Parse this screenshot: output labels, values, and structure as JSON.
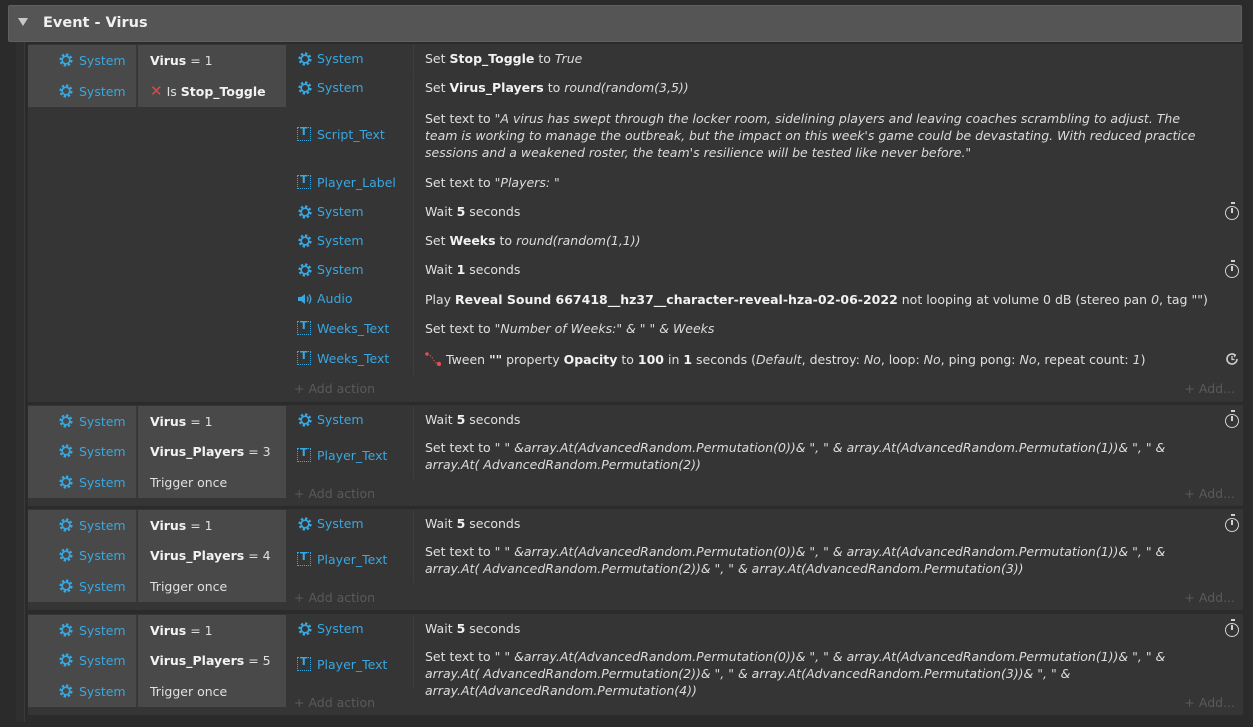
{
  "group": {
    "title": "Event - Virus"
  },
  "labels": {
    "add_action": "+ Add action",
    "add_more": "+ Add..."
  },
  "events": [
    {
      "conditions": [
        {
          "object": "System",
          "parts": [
            {
              "t": "Virus",
              "b": true
            },
            {
              "t": " = 1"
            }
          ]
        },
        {
          "object": "System",
          "inverted": true,
          "parts": [
            {
              "t": "Is "
            },
            {
              "t": "Stop_Toggle",
              "b": true
            }
          ]
        }
      ],
      "actions": [
        {
          "object": "System",
          "icon": "gear",
          "parts": [
            {
              "t": "Set "
            },
            {
              "t": "Stop_Toggle",
              "b": true
            },
            {
              "t": " to "
            },
            {
              "t": "True",
              "i": true
            }
          ]
        },
        {
          "object": "System",
          "icon": "gear",
          "parts": [
            {
              "t": "Set "
            },
            {
              "t": "Virus_Players",
              "b": true
            },
            {
              "t": " to "
            },
            {
              "t": "round(random(3,5))",
              "i": true
            }
          ]
        },
        {
          "object": "Script_Text",
          "icon": "text",
          "parts": [
            {
              "t": "Set text to "
            },
            {
              "t": "\"A virus has swept through the locker room, sidelining players and leaving coaches scrambling to adjust. The team is working to manage the outbreak, but the impact on this week's game could be devastating. With reduced practice sessions and a weakened roster, the team's resilience will be tested like never before.\"",
              "i": true
            }
          ]
        },
        {
          "object": "Player_Label",
          "icon": "text",
          "parts": [
            {
              "t": "Set text to "
            },
            {
              "t": "\"Players: \"",
              "i": true
            }
          ]
        },
        {
          "object": "System",
          "icon": "gear",
          "timer": true,
          "parts": [
            {
              "t": "Wait "
            },
            {
              "t": "5",
              "b": true
            },
            {
              "t": " seconds"
            }
          ]
        },
        {
          "object": "System",
          "icon": "gear",
          "parts": [
            {
              "t": "Set "
            },
            {
              "t": "Weeks",
              "b": true
            },
            {
              "t": " to "
            },
            {
              "t": "round(random(1,1))",
              "i": true
            }
          ]
        },
        {
          "object": "System",
          "icon": "gear",
          "timer": true,
          "parts": [
            {
              "t": "Wait "
            },
            {
              "t": "1",
              "b": true
            },
            {
              "t": " seconds"
            }
          ]
        },
        {
          "object": "Audio",
          "icon": "audio",
          "parts": [
            {
              "t": "Play "
            },
            {
              "t": "Reveal Sound 667418__hz37__character-reveal-hza-02-06-2022",
              "b": true
            },
            {
              "t": " not looping at volume 0 dB (stereo pan "
            },
            {
              "t": "0",
              "i": true
            },
            {
              "t": ", tag \"\")"
            }
          ]
        },
        {
          "object": "Weeks_Text",
          "icon": "text",
          "parts": [
            {
              "t": "Set text to "
            },
            {
              "t": "\"Number of Weeks:\" & \" \" & Weeks",
              "i": true
            }
          ]
        },
        {
          "object": "Weeks_Text",
          "icon": "text",
          "tween": true,
          "parts": [
            {
              "t": "Tween "
            },
            {
              "t": "\"\"",
              "b": true
            },
            {
              "t": " property "
            },
            {
              "t": "Opacity",
              "b": true
            },
            {
              "t": " to "
            },
            {
              "t": "100",
              "b": true
            },
            {
              "t": " in "
            },
            {
              "t": "1",
              "b": true
            },
            {
              "t": " seconds ("
            },
            {
              "t": "Default",
              "i": true
            },
            {
              "t": ", destroy: "
            },
            {
              "t": "No",
              "i": true
            },
            {
              "t": ", loop: "
            },
            {
              "t": "No",
              "i": true
            },
            {
              "t": ", ping pong: "
            },
            {
              "t": "No",
              "i": true
            },
            {
              "t": ", repeat count: "
            },
            {
              "t": "1",
              "i": true
            },
            {
              "t": ")"
            }
          ]
        }
      ]
    },
    {
      "conditions": [
        {
          "object": "System",
          "parts": [
            {
              "t": "Virus",
              "b": true
            },
            {
              "t": " = 1"
            }
          ]
        },
        {
          "object": "System",
          "parts": [
            {
              "t": "Virus_Players",
              "b": true
            },
            {
              "t": " = 3"
            }
          ]
        },
        {
          "object": "System",
          "parts": [
            {
              "t": "Trigger once"
            }
          ]
        }
      ],
      "actions": [
        {
          "object": "System",
          "icon": "gear",
          "timer": true,
          "parts": [
            {
              "t": "Wait "
            },
            {
              "t": "5",
              "b": true
            },
            {
              "t": " seconds"
            }
          ]
        },
        {
          "object": "Player_Text",
          "icon": "text",
          "parts": [
            {
              "t": "Set text to "
            },
            {
              "t": "\" \" &array.At(AdvancedRandom.Permutation(0))& \", \" & array.At(AdvancedRandom.Permutation(1))& \", \" & array.At( AdvancedRandom.Permutation(2))",
              "i": true
            }
          ]
        }
      ]
    },
    {
      "conditions": [
        {
          "object": "System",
          "parts": [
            {
              "t": "Virus",
              "b": true
            },
            {
              "t": " = 1"
            }
          ]
        },
        {
          "object": "System",
          "parts": [
            {
              "t": "Virus_Players",
              "b": true
            },
            {
              "t": " = 4"
            }
          ]
        },
        {
          "object": "System",
          "parts": [
            {
              "t": "Trigger once"
            }
          ]
        }
      ],
      "actions": [
        {
          "object": "System",
          "icon": "gear",
          "timer": true,
          "parts": [
            {
              "t": "Wait "
            },
            {
              "t": "5",
              "b": true
            },
            {
              "t": " seconds"
            }
          ]
        },
        {
          "object": "Player_Text",
          "icon": "text",
          "parts": [
            {
              "t": "Set text to "
            },
            {
              "t": "\" \" &array.At(AdvancedRandom.Permutation(0))& \", \" & array.At(AdvancedRandom.Permutation(1))& \", \" & array.At( AdvancedRandom.Permutation(2))& \", \" & array.At(AdvancedRandom.Permutation(3))",
              "i": true
            }
          ]
        }
      ]
    },
    {
      "conditions": [
        {
          "object": "System",
          "parts": [
            {
              "t": "Virus",
              "b": true
            },
            {
              "t": " = 1"
            }
          ]
        },
        {
          "object": "System",
          "parts": [
            {
              "t": "Virus_Players",
              "b": true
            },
            {
              "t": " = 5"
            }
          ]
        },
        {
          "object": "System",
          "parts": [
            {
              "t": "Trigger once"
            }
          ]
        }
      ],
      "actions": [
        {
          "object": "System",
          "icon": "gear",
          "timer": true,
          "parts": [
            {
              "t": "Wait "
            },
            {
              "t": "5",
              "b": true
            },
            {
              "t": " seconds"
            }
          ]
        },
        {
          "object": "Player_Text",
          "icon": "text",
          "parts": [
            {
              "t": "Set text to "
            },
            {
              "t": "\" \" &array.At(AdvancedRandom.Permutation(0))& \", \" & array.At(AdvancedRandom.Permutation(1))& \", \" & array.At( AdvancedRandom.Permutation(2))& \", \" & array.At(AdvancedRandom.Permutation(3))& \", \" & array.At(AdvancedRandom.Permutation(4))",
              "i": true
            }
          ]
        }
      ]
    }
  ]
}
